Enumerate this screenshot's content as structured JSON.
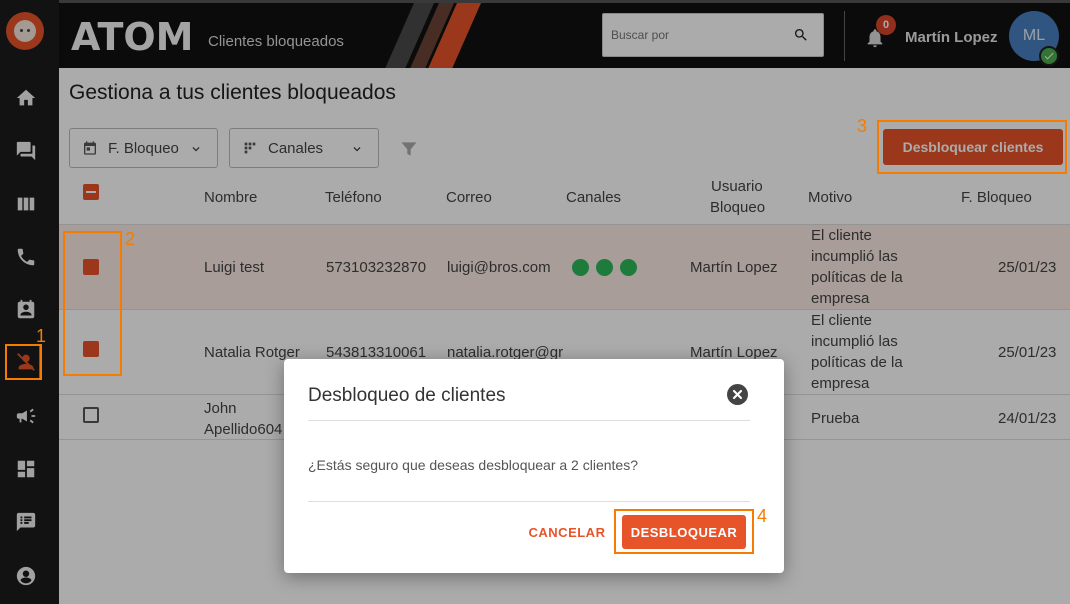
{
  "app": {
    "brand": "ATOM",
    "breadcrumb": "Clientes bloqueados"
  },
  "header": {
    "search_placeholder": "Buscar por",
    "notification_count": "0",
    "user_name": "Martín Lopez",
    "avatar_initials": "ML"
  },
  "sidebar": {
    "items": [
      {
        "icon": "home-icon"
      },
      {
        "icon": "chat-icon"
      },
      {
        "icon": "columns-icon"
      },
      {
        "icon": "phone-icon"
      },
      {
        "icon": "contacts-icon"
      },
      {
        "icon": "blocked-user-icon",
        "active": true
      },
      {
        "icon": "campaign-icon"
      },
      {
        "icon": "dashboard-icon"
      },
      {
        "icon": "feedback-icon"
      },
      {
        "icon": "account-icon"
      }
    ]
  },
  "page": {
    "title": "Gestiona a tus clientes bloqueados",
    "filter_date": "F. Bloqueo",
    "filter_channels": "Canales",
    "unlock_button": "Desbloquear clientes"
  },
  "table": {
    "headers": {
      "name": "Nombre",
      "phone": "Teléfono",
      "email": "Correo",
      "channels": "Canales",
      "blocker_line1": "Usuario",
      "blocker_line2": "Bloqueo",
      "reason": "Motivo",
      "date": "F. Bloqueo"
    },
    "rows": [
      {
        "checked": true,
        "name": "Luigi test",
        "name2": "",
        "phone": "573103232870",
        "email": "luigi@bros.com",
        "channels": [
          "whatsapp-icon",
          "whatsapp-icon",
          "whatsapp-icon"
        ],
        "blocker": "Martín Lopez",
        "reason_lines": [
          "El cliente",
          "incumplió las",
          "políticas de la",
          "empresa"
        ],
        "date": "25/01/23"
      },
      {
        "checked": true,
        "name": "Natalia Rotger",
        "name2": "",
        "phone": "543813310061",
        "email": "natalia.rotger@gr",
        "channels": [],
        "blocker": "Martín Lopez",
        "reason_lines": [
          "El cliente",
          "incumplió las",
          "políticas de la",
          "empresa"
        ],
        "date": "25/01/23"
      },
      {
        "checked": false,
        "name": "John",
        "name2": "Apellido604",
        "phone": "",
        "email": "",
        "channels": [],
        "blocker": "",
        "reason_lines": [
          "Prueba"
        ],
        "date": "24/01/23"
      }
    ]
  },
  "dialog": {
    "title": "Desbloqueo de clientes",
    "message": "¿Estás seguro que deseas desbloquear a 2 clientes?",
    "cancel": "CANCELAR",
    "confirm": "DESBLOQUEAR"
  },
  "annotations": [
    "1",
    "2",
    "3",
    "4"
  ],
  "colors": {
    "accent": "#e8542a",
    "annotation": "#f57c00",
    "sidebar": "#1c1c1c",
    "header": "#111111",
    "whatsapp": "#2fb85a"
  }
}
